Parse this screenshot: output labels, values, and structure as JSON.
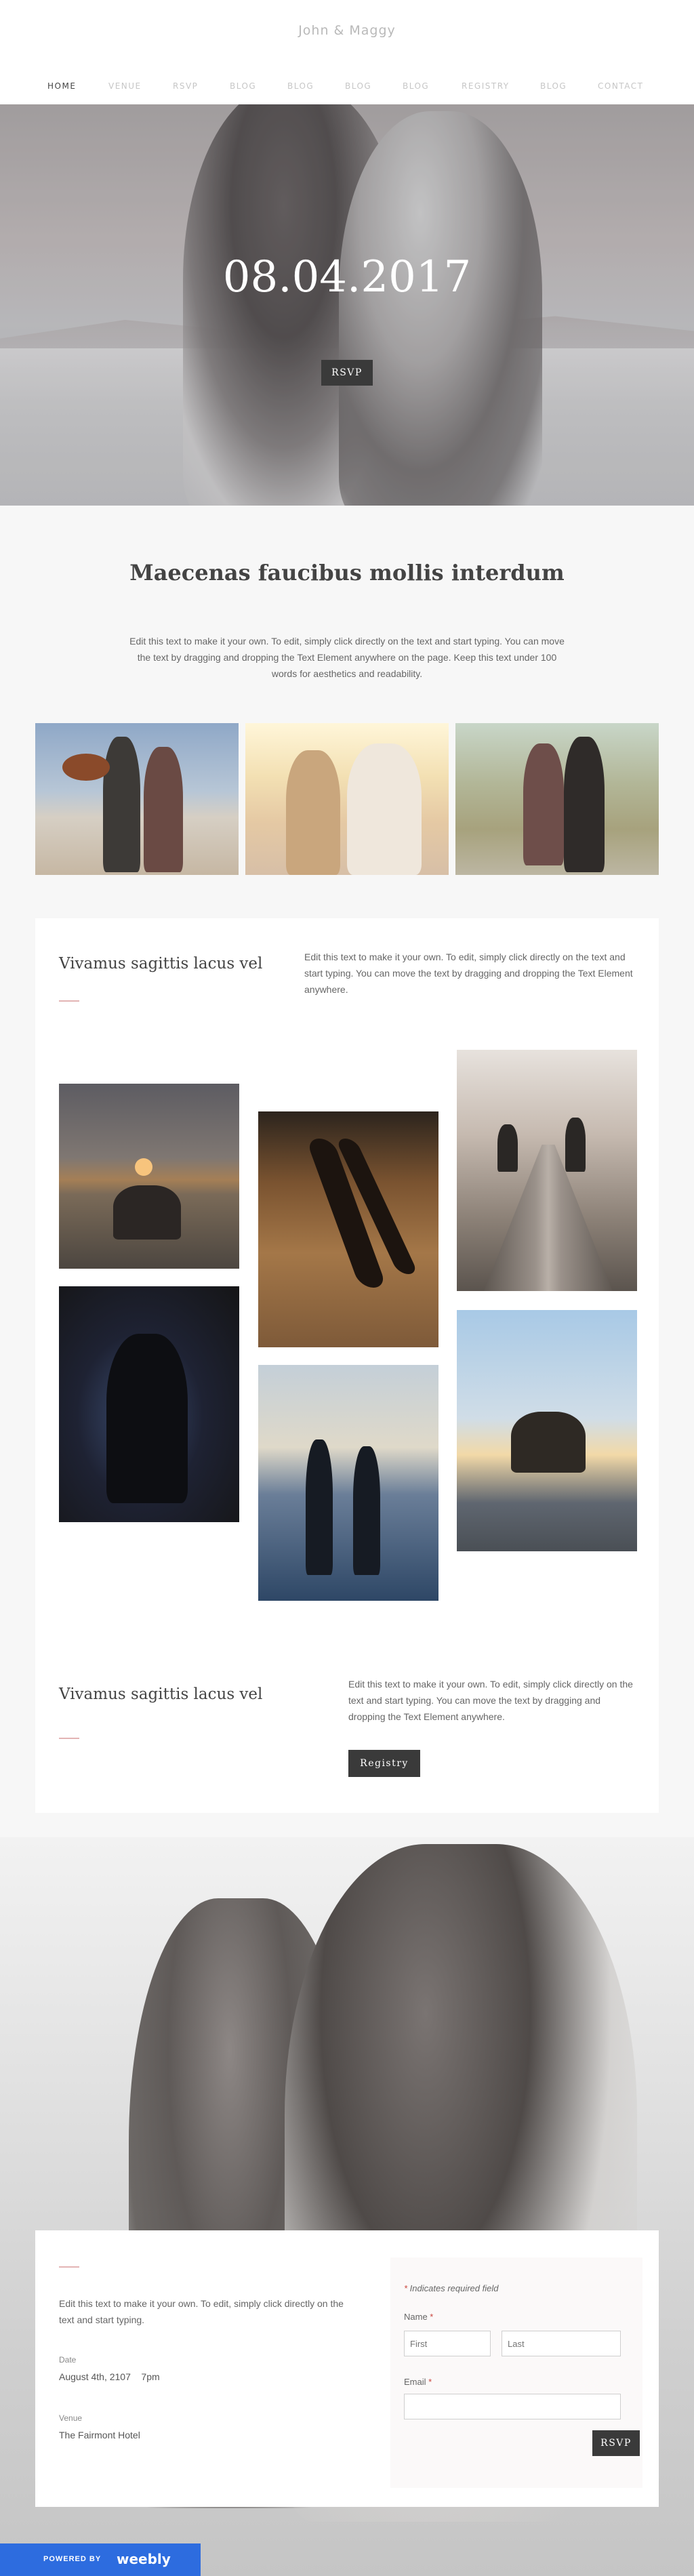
{
  "site": {
    "title": "John & Maggy"
  },
  "nav": [
    {
      "label": "HOME",
      "active": true
    },
    {
      "label": "VENUE"
    },
    {
      "label": "RSVP"
    },
    {
      "label": "BLOG"
    },
    {
      "label": "BLOG"
    },
    {
      "label": "BLOG"
    },
    {
      "label": "BLOG"
    },
    {
      "label": "REGISTRY"
    },
    {
      "label": "BLOG"
    },
    {
      "label": "CONTACT"
    }
  ],
  "hero": {
    "date": "08.04.2017",
    "button": "RSVP"
  },
  "intro": {
    "heading": "Maecenas faucibus mollis interdum",
    "text": "Edit this text to make it your own. To edit, simply click directly on the text and start typing. You can move the text by dragging and dropping the Text Element anywhere on the page. Keep this text under 100 words for aesthetics and readability."
  },
  "section1": {
    "title": "Vivamus sagittis lacus vel",
    "text": "Edit this text to make it your own. To edit, simply click directly on the text and start typing. You can move the text by dragging and dropping the Text Element anywhere."
  },
  "section2": {
    "title": "Vivamus sagittis lacus vel",
    "text": "Edit this text to make it your own. To edit, simply click directly on the text and start typing. You can move the text by dragging and dropping the Text Element anywhere.",
    "button": "Registry"
  },
  "rsvp": {
    "intro": "Edit this text to make it your own. To edit, simply click directly on the text and start typing.",
    "date_label": "Date",
    "date_value": "August 4th, 2107    7pm",
    "venue_label": "Venue",
    "venue_value": "The Fairmont Hotel",
    "required_note": "Indicates required field",
    "name_label": "Name",
    "first_placeholder": "First",
    "last_placeholder": "Last",
    "email_label": "Email",
    "submit": "RSVP"
  },
  "footer": {
    "powered_by": "POWERED BY",
    "brand": "weebly"
  },
  "colors": {
    "accent_line": "#e3b4b4",
    "button": "#3a3a3a",
    "weebly_blue": "#2d6cdf",
    "required": "#c9453d"
  }
}
